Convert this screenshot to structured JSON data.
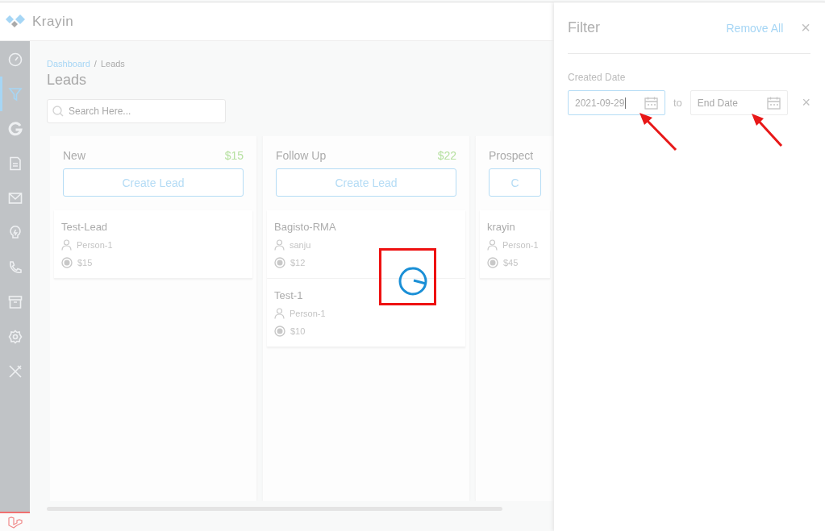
{
  "header": {
    "logo_text": "Krayin"
  },
  "sidebar": {
    "items": [
      {
        "selected": false
      },
      {
        "selected": true
      },
      {
        "selected": false
      },
      {
        "selected": false
      },
      {
        "selected": false
      },
      {
        "selected": false
      },
      {
        "selected": false
      },
      {
        "selected": false
      },
      {
        "selected": false
      },
      {
        "selected": false
      }
    ]
  },
  "breadcrumb": {
    "link": "Dashboard",
    "separator": "/",
    "current": "Leads"
  },
  "page_title": "Leads",
  "search": {
    "placeholder": "Search Here..."
  },
  "columns": [
    {
      "name": "New",
      "total": "$15",
      "button": "Create Lead",
      "cards": [
        {
          "title": "Test-Lead",
          "person": "Person-1",
          "amount": "$15"
        }
      ]
    },
    {
      "name": "Follow Up",
      "total": "$22",
      "button": "Create Lead",
      "cards": [
        {
          "title": "Bagisto-RMA",
          "person": "sanju",
          "amount": "$12"
        },
        {
          "title": "Test-1",
          "person": "Person-1",
          "amount": "$10"
        }
      ]
    },
    {
      "name": "Prospect",
      "button": "C",
      "cards": [
        {
          "title": "krayin",
          "person": "Person-1",
          "amount": "$45"
        }
      ]
    }
  ],
  "filter": {
    "title": "Filter",
    "remove_all": "Remove All",
    "close": "×",
    "fields": [
      {
        "label": "Created Date",
        "start_value": "2021-09-29",
        "end_placeholder": "End Date",
        "separator": "to",
        "clear": "×"
      }
    ]
  }
}
